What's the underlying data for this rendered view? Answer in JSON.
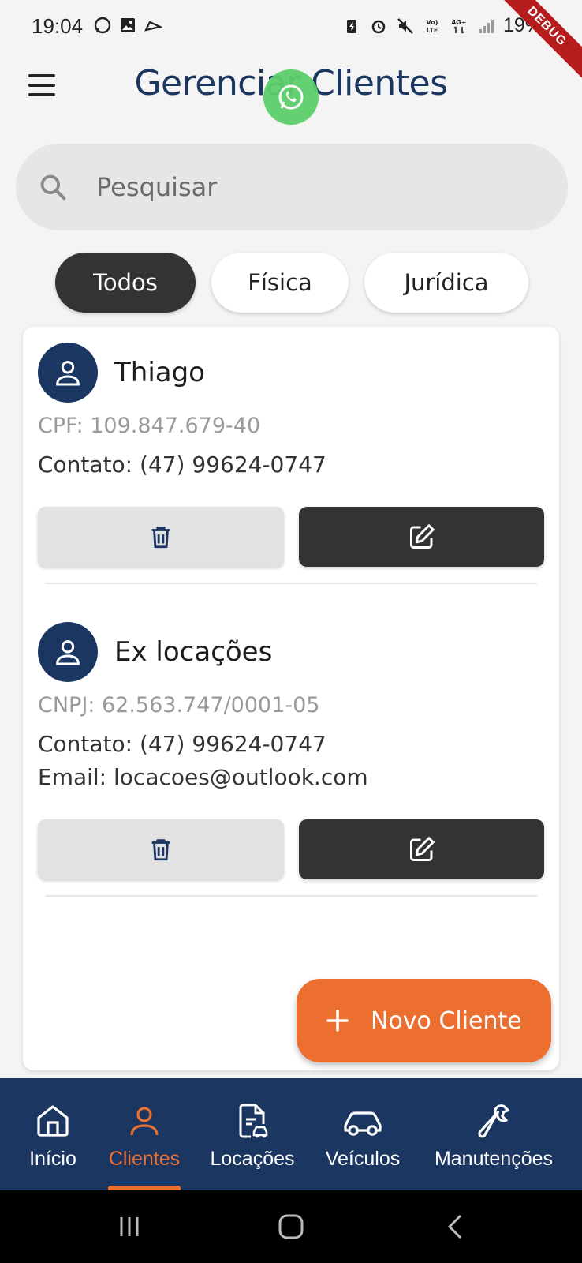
{
  "status_bar": {
    "time": "19:04",
    "battery": "19%",
    "debug_label": "DEBUG",
    "network_label": "4G+",
    "volte_label": "Vo) LTE"
  },
  "header": {
    "title": "Gerenciar Clientes"
  },
  "search": {
    "placeholder": "Pesquisar",
    "value": ""
  },
  "filters": [
    {
      "label": "Todos",
      "active": true
    },
    {
      "label": "Física",
      "active": false
    },
    {
      "label": "Jurídica",
      "active": false
    }
  ],
  "clients": [
    {
      "name": "Thiago",
      "document": "CPF: 109.847.679-40",
      "contact": "Contato: (47) 99624-0747"
    },
    {
      "name": "Ex locações",
      "document": "CNPJ: 62.563.747/0001-05",
      "contact": "Contato: (47) 99624-0747",
      "email": "Email: locacoes@outlook.com"
    }
  ],
  "fab": {
    "label": "Novo Cliente"
  },
  "bottom_nav": [
    {
      "label": "Início",
      "icon": "home-icon",
      "active": false
    },
    {
      "label": "Clientes",
      "icon": "person-icon",
      "active": true
    },
    {
      "label": "Locações",
      "icon": "document-car-icon",
      "active": false
    },
    {
      "label": "Veículos",
      "icon": "car-icon",
      "active": false
    },
    {
      "label": "Manutenções",
      "icon": "wrench-icon",
      "active": false
    }
  ],
  "colors": {
    "primary": "#1b3661",
    "accent": "#ec6f30",
    "dark": "#333333",
    "background": "#f4f4f4"
  }
}
